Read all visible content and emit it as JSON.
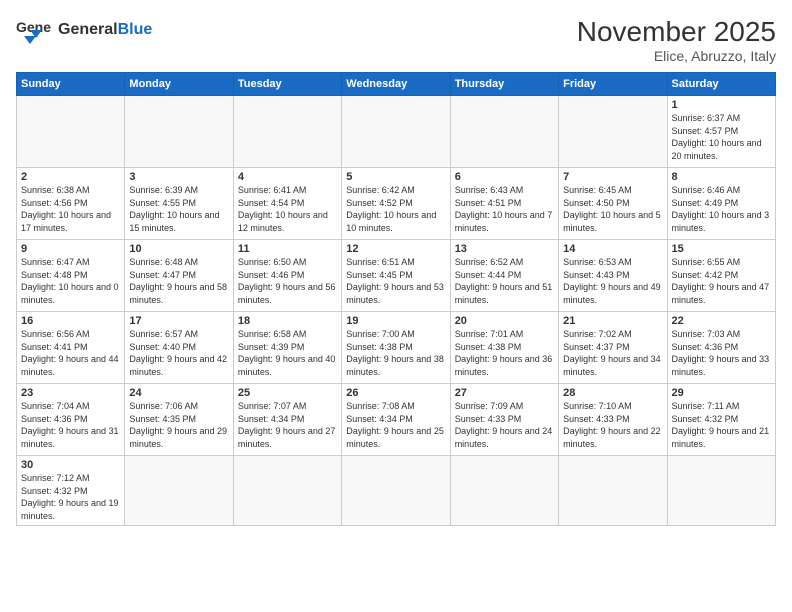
{
  "logo": {
    "general": "General",
    "blue": "Blue"
  },
  "title": "November 2025",
  "subtitle": "Elice, Abruzzo, Italy",
  "days_of_week": [
    "Sunday",
    "Monday",
    "Tuesday",
    "Wednesday",
    "Thursday",
    "Friday",
    "Saturday"
  ],
  "weeks": [
    [
      {
        "day": "",
        "info": ""
      },
      {
        "day": "",
        "info": ""
      },
      {
        "day": "",
        "info": ""
      },
      {
        "day": "",
        "info": ""
      },
      {
        "day": "",
        "info": ""
      },
      {
        "day": "",
        "info": ""
      },
      {
        "day": "1",
        "info": "Sunrise: 6:37 AM\nSunset: 4:57 PM\nDaylight: 10 hours and 20 minutes."
      }
    ],
    [
      {
        "day": "2",
        "info": "Sunrise: 6:38 AM\nSunset: 4:56 PM\nDaylight: 10 hours and 17 minutes."
      },
      {
        "day": "3",
        "info": "Sunrise: 6:39 AM\nSunset: 4:55 PM\nDaylight: 10 hours and 15 minutes."
      },
      {
        "day": "4",
        "info": "Sunrise: 6:41 AM\nSunset: 4:54 PM\nDaylight: 10 hours and 12 minutes."
      },
      {
        "day": "5",
        "info": "Sunrise: 6:42 AM\nSunset: 4:52 PM\nDaylight: 10 hours and 10 minutes."
      },
      {
        "day": "6",
        "info": "Sunrise: 6:43 AM\nSunset: 4:51 PM\nDaylight: 10 hours and 7 minutes."
      },
      {
        "day": "7",
        "info": "Sunrise: 6:45 AM\nSunset: 4:50 PM\nDaylight: 10 hours and 5 minutes."
      },
      {
        "day": "8",
        "info": "Sunrise: 6:46 AM\nSunset: 4:49 PM\nDaylight: 10 hours and 3 minutes."
      }
    ],
    [
      {
        "day": "9",
        "info": "Sunrise: 6:47 AM\nSunset: 4:48 PM\nDaylight: 10 hours and 0 minutes."
      },
      {
        "day": "10",
        "info": "Sunrise: 6:48 AM\nSunset: 4:47 PM\nDaylight: 9 hours and 58 minutes."
      },
      {
        "day": "11",
        "info": "Sunrise: 6:50 AM\nSunset: 4:46 PM\nDaylight: 9 hours and 56 minutes."
      },
      {
        "day": "12",
        "info": "Sunrise: 6:51 AM\nSunset: 4:45 PM\nDaylight: 9 hours and 53 minutes."
      },
      {
        "day": "13",
        "info": "Sunrise: 6:52 AM\nSunset: 4:44 PM\nDaylight: 9 hours and 51 minutes."
      },
      {
        "day": "14",
        "info": "Sunrise: 6:53 AM\nSunset: 4:43 PM\nDaylight: 9 hours and 49 minutes."
      },
      {
        "day": "15",
        "info": "Sunrise: 6:55 AM\nSunset: 4:42 PM\nDaylight: 9 hours and 47 minutes."
      }
    ],
    [
      {
        "day": "16",
        "info": "Sunrise: 6:56 AM\nSunset: 4:41 PM\nDaylight: 9 hours and 44 minutes."
      },
      {
        "day": "17",
        "info": "Sunrise: 6:57 AM\nSunset: 4:40 PM\nDaylight: 9 hours and 42 minutes."
      },
      {
        "day": "18",
        "info": "Sunrise: 6:58 AM\nSunset: 4:39 PM\nDaylight: 9 hours and 40 minutes."
      },
      {
        "day": "19",
        "info": "Sunrise: 7:00 AM\nSunset: 4:38 PM\nDaylight: 9 hours and 38 minutes."
      },
      {
        "day": "20",
        "info": "Sunrise: 7:01 AM\nSunset: 4:38 PM\nDaylight: 9 hours and 36 minutes."
      },
      {
        "day": "21",
        "info": "Sunrise: 7:02 AM\nSunset: 4:37 PM\nDaylight: 9 hours and 34 minutes."
      },
      {
        "day": "22",
        "info": "Sunrise: 7:03 AM\nSunset: 4:36 PM\nDaylight: 9 hours and 33 minutes."
      }
    ],
    [
      {
        "day": "23",
        "info": "Sunrise: 7:04 AM\nSunset: 4:36 PM\nDaylight: 9 hours and 31 minutes."
      },
      {
        "day": "24",
        "info": "Sunrise: 7:06 AM\nSunset: 4:35 PM\nDaylight: 9 hours and 29 minutes."
      },
      {
        "day": "25",
        "info": "Sunrise: 7:07 AM\nSunset: 4:34 PM\nDaylight: 9 hours and 27 minutes."
      },
      {
        "day": "26",
        "info": "Sunrise: 7:08 AM\nSunset: 4:34 PM\nDaylight: 9 hours and 25 minutes."
      },
      {
        "day": "27",
        "info": "Sunrise: 7:09 AM\nSunset: 4:33 PM\nDaylight: 9 hours and 24 minutes."
      },
      {
        "day": "28",
        "info": "Sunrise: 7:10 AM\nSunset: 4:33 PM\nDaylight: 9 hours and 22 minutes."
      },
      {
        "day": "29",
        "info": "Sunrise: 7:11 AM\nSunset: 4:32 PM\nDaylight: 9 hours and 21 minutes."
      }
    ],
    [
      {
        "day": "30",
        "info": "Sunrise: 7:12 AM\nSunset: 4:32 PM\nDaylight: 9 hours and 19 minutes."
      },
      {
        "day": "",
        "info": ""
      },
      {
        "day": "",
        "info": ""
      },
      {
        "day": "",
        "info": ""
      },
      {
        "day": "",
        "info": ""
      },
      {
        "day": "",
        "info": ""
      },
      {
        "day": "",
        "info": ""
      }
    ]
  ]
}
